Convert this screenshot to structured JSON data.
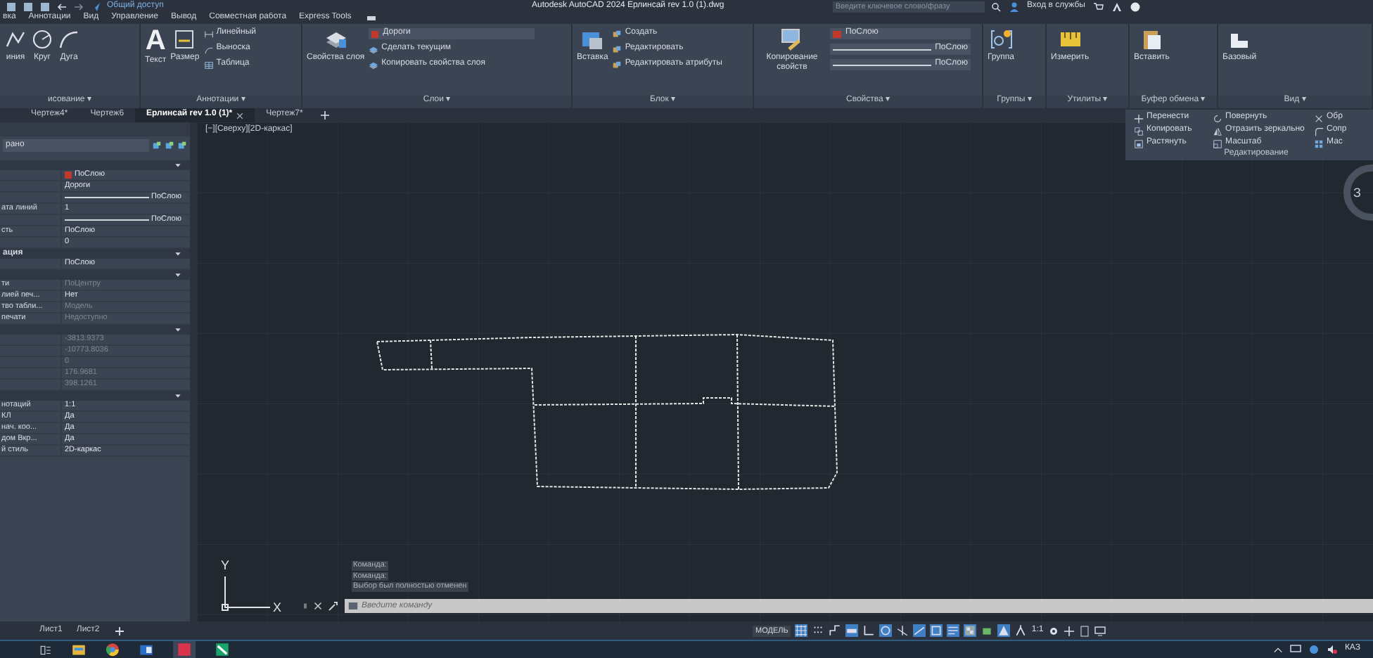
{
  "quick_access": {
    "share_label": "Общий доступ"
  },
  "title": "Autodesk AutoCAD 2024  Ерлинсай rev 1.0 (1).dwg",
  "search": {
    "placeholder": "Введите ключевое слово/фразу"
  },
  "sign_in": "Вход в службы",
  "ribbon_tabs": [
    "вка",
    "Аннотации",
    "Вид",
    "Управление",
    "Вывод",
    "Совместная работа",
    "Express Tools"
  ],
  "ribbon_panels": [
    {
      "label": "исование ▾",
      "big_buttons": [
        "иния",
        "Круг",
        "Дуга"
      ]
    },
    {
      "label": "Аннотации ▾",
      "text_icon": "A",
      "big_buttons": [
        "Текст",
        "Размер"
      ],
      "small_buttons": [
        "Линейный",
        "Выноска",
        "Таблица"
      ]
    },
    {
      "label": "Слои ▾",
      "big_buttons": [
        "Свойства слоя"
      ],
      "layer": {
        "text": "Дороги",
        "color": "#c0392b"
      },
      "small_buttons": [
        "Сделать текущим",
        "Копировать свойства слоя"
      ]
    },
    {
      "label": "Блок ▾",
      "big_buttons": [
        "Вставка"
      ],
      "small_buttons": [
        "Создать",
        "Редактировать",
        "Редактировать атрибуты"
      ]
    },
    {
      "label": "Свойства ▾",
      "big_buttons": [
        "Копирование свойств"
      ],
      "dropdowns": [
        {
          "kind": "color",
          "text": "ПоСлою",
          "color": "#c0392b"
        },
        {
          "kind": "linetype",
          "text": "ПоСлою"
        },
        {
          "kind": "linetype",
          "text": "ПоСлою"
        }
      ]
    },
    {
      "label": "Группы ▾",
      "big_buttons": [
        "Группа"
      ]
    },
    {
      "label": "Утилиты ▾",
      "big_buttons": [
        "Измерить"
      ]
    },
    {
      "label": "Буфер обмена ▾",
      "big_buttons": [
        "Вставить"
      ]
    },
    {
      "label": "Вид ▾",
      "big_buttons": [
        "Базовый"
      ]
    }
  ],
  "document_tabs": [
    {
      "label": "Чертеж4*",
      "selected": false
    },
    {
      "label": "Чертеж6",
      "selected": false
    },
    {
      "label": "Ерлинсай rev 1.0 (1)*",
      "selected": true
    },
    {
      "label": "Чертеж7*",
      "selected": false
    }
  ],
  "edit_panel": {
    "label": "Редактирование",
    "items": [
      "Перенести",
      "Повернуть",
      "Обр",
      "Копировать",
      "Отразить зеркально",
      "Сопр",
      "Растянуть",
      "Масштаб",
      "Мас"
    ]
  },
  "viewport_label": "[−][Сверху][2D-каркас]",
  "viewcube_label": "З",
  "properties_panel": {
    "selection": "рано",
    "sections": [
      {
        "rows": [
          {
            "label": "",
            "value": "ПоСлою",
            "kind": "color",
            "color": "#c0392b",
            "disabled": false
          },
          {
            "label": "",
            "value": "Дороги",
            "kind": "text",
            "disabled": false
          },
          {
            "label": "",
            "value": "ПоСлою",
            "kind": "linetype",
            "disabled": false
          },
          {
            "label": "ата линий",
            "value": "1",
            "kind": "text",
            "disabled": false
          },
          {
            "label": "",
            "value": "ПоСлою",
            "kind": "linetype",
            "disabled": false
          },
          {
            "label": "сть",
            "value": "ПоСлою",
            "kind": "text",
            "disabled": false
          },
          {
            "label": "",
            "value": "0",
            "kind": "text",
            "disabled": false
          }
        ]
      },
      {
        "title": "ация",
        "rows": [
          {
            "label": "",
            "value": "ПоСлою",
            "kind": "text",
            "disabled": false
          }
        ]
      },
      {
        "rows": [
          {
            "label": "ти",
            "value": "ПоЦентру",
            "kind": "text",
            "disabled": true
          },
          {
            "label": "лией печ...",
            "value": "Нет",
            "kind": "text",
            "disabled": false
          },
          {
            "label": "тво табли...",
            "value": "Модель",
            "kind": "text",
            "disabled": true
          },
          {
            "label": "печати",
            "value": "Недоступно",
            "kind": "text",
            "disabled": true
          }
        ]
      },
      {
        "rows": [
          {
            "label": "",
            "value": "-3813.9373",
            "kind": "text",
            "disabled": true
          },
          {
            "label": "",
            "value": "-10773.8036",
            "kind": "text",
            "disabled": true
          },
          {
            "label": "",
            "value": "0",
            "kind": "text",
            "disabled": true
          },
          {
            "label": "",
            "value": "176.9681",
            "kind": "text",
            "disabled": true
          },
          {
            "label": "",
            "value": "398.1261",
            "kind": "text",
            "disabled": true
          }
        ]
      },
      {
        "rows": [
          {
            "label": "нотаций",
            "value": "1:1",
            "kind": "text",
            "disabled": false
          },
          {
            "label": "КЛ",
            "value": "Да",
            "kind": "text",
            "disabled": false
          },
          {
            "label": "нач. коо...",
            "value": "Да",
            "kind": "text",
            "disabled": false
          },
          {
            "label": "дом Вкр...",
            "value": "Да",
            "kind": "text",
            "disabled": false
          },
          {
            "label": "й стиль",
            "value": "2D-каркас",
            "kind": "text",
            "disabled": false
          }
        ]
      }
    ]
  },
  "ucs": {
    "x_label": "X",
    "y_label": "Y"
  },
  "command_history": [
    "Команда:",
    "Команда:",
    "Выбор был полностью отменен"
  ],
  "command_input": {
    "placeholder": "Введите команду"
  },
  "layout_tabs": [
    "Лист1",
    "Лист2"
  ],
  "status_bar": {
    "model_label": "МОДЕЛЬ",
    "scale": "1:1",
    "toggles": [
      {
        "kind": "grid",
        "on": true
      },
      {
        "kind": "snap",
        "on": false
      },
      {
        "kind": "infer",
        "on": false
      },
      {
        "kind": "dynamic-input",
        "on": true
      },
      {
        "kind": "ortho",
        "on": false
      },
      {
        "kind": "polar",
        "on": true
      },
      {
        "kind": "isodraft",
        "on": false
      },
      {
        "kind": "tracking",
        "on": true
      },
      {
        "kind": "osnap",
        "on": true
      },
      {
        "kind": "lineweight",
        "on": true
      },
      {
        "kind": "transparency",
        "on": true
      },
      {
        "kind": "selection",
        "on": false
      },
      {
        "kind": "annotation",
        "on": true
      },
      {
        "kind": "autoscale",
        "on": false
      }
    ]
  },
  "tray": {
    "language": "КАЗ"
  }
}
